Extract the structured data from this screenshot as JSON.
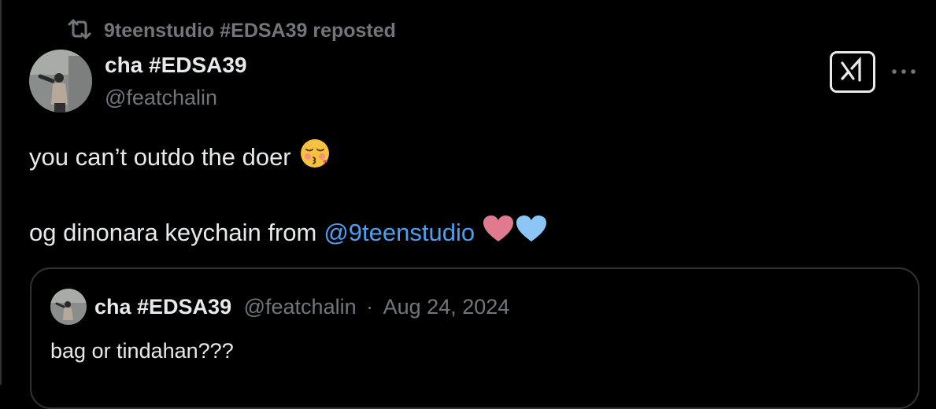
{
  "repost": {
    "icon": "repost-icon",
    "text": "9teenstudio #EDSA39 reposted"
  },
  "post": {
    "author": {
      "display_name": "cha #EDSA39",
      "handle": "@featchalin",
      "avatar": "avatar"
    },
    "actions": {
      "grok_icon": "grok-icon",
      "more_icon": "more-icon"
    },
    "line1": "you can’t outdo the doer",
    "line1_emoji": "kissing-face-with-closed-eyes-icon",
    "line2_prefix": "og dinonara keychain from",
    "line2_mention": "@9teenstudio",
    "line2_emojis": [
      "pink-heart-icon",
      "light-blue-heart-icon"
    ]
  },
  "quote": {
    "display_name": "cha #EDSA39",
    "handle": "@featchalin",
    "separator": "·",
    "date": "Aug 24, 2024",
    "text": "bag or tindahan???"
  },
  "colors": {
    "background": "#000000",
    "text": "#e7e9ea",
    "muted": "#71767b",
    "mention": "#4c9ff0",
    "border": "#2f3336",
    "pink_heart": "#e07a8f",
    "blue_heart": "#8cc6f7"
  }
}
